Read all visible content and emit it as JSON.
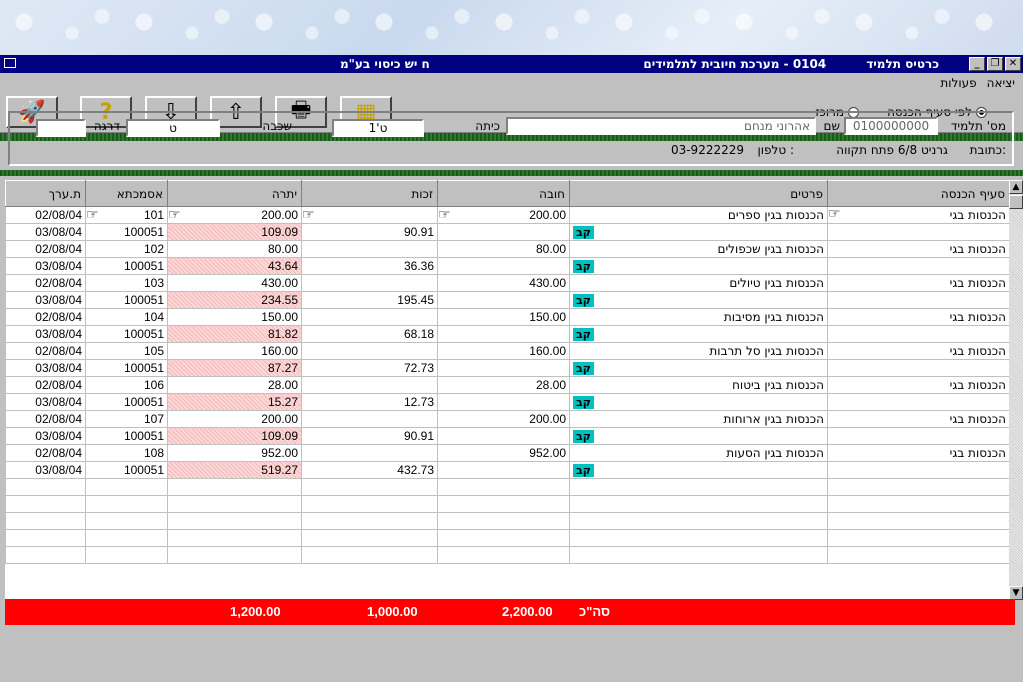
{
  "window": {
    "title": "כרטיס תלמיד",
    "subtitle": "0104 - מערכת חיובית לתלמידים",
    "school": "ח   יש כיסוי בע\"מ"
  },
  "menu": [
    "פעולות",
    "יציאה"
  ],
  "radios": [
    {
      "label": "לפי סעיף הכנסה",
      "checked": true
    },
    {
      "label": "מרוכז",
      "checked": false
    }
  ],
  "toolbar_icons": [
    "exit-rocket-icon",
    "help-icon",
    "arrow-down-icon",
    "arrow-up-icon",
    "print-icon",
    "calculator-icon"
  ],
  "student": {
    "id_label": "מס' תלמיד",
    "id_value": "0100000000",
    "name_label": "שם",
    "name_value": "אהרוני מנחם",
    "class_label": "כיתה",
    "class_value": "ט'1",
    "grade_label": "שכבה",
    "grade_value": "ט",
    "level_label": "דרגה",
    "level_value": "",
    "address_label": "כתובת:",
    "address_value": "גרניט 6/8  פתח תקווה",
    "phone_label": "טלפון :",
    "phone_value": "03-9222229"
  },
  "columns": [
    "סעיף הכנסה",
    "פרטים",
    "חובה",
    "זכות",
    "יתרה",
    "אסמכתא",
    "ת.ערך"
  ],
  "rows": [
    {
      "section": "הכנסות בגי",
      "details": "הכנסות בגין ספרים",
      "debit": "200.00",
      "credit": "",
      "balance": "200.00",
      "ref": "101",
      "date": "02/08/04",
      "hl": false,
      "kav": false,
      "hand": true
    },
    {
      "section": "",
      "details": "",
      "debit": "",
      "credit": "90.91",
      "balance": "109.09",
      "ref": "100051",
      "date": "03/08/04",
      "hl": true,
      "kav": true,
      "hand": false
    },
    {
      "section": "הכנסות בגי",
      "details": "הכנסות בגין שכפולים",
      "debit": "80.00",
      "credit": "",
      "balance": "80.00",
      "ref": "102",
      "date": "02/08/04",
      "hl": false,
      "kav": false,
      "hand": false
    },
    {
      "section": "",
      "details": "",
      "debit": "",
      "credit": "36.36",
      "balance": "43.64",
      "ref": "100051",
      "date": "03/08/04",
      "hl": true,
      "kav": true,
      "hand": false
    },
    {
      "section": "הכנסות בגי",
      "details": "הכנסות בגין טיולים",
      "debit": "430.00",
      "credit": "",
      "balance": "430.00",
      "ref": "103",
      "date": "02/08/04",
      "hl": false,
      "kav": false,
      "hand": false
    },
    {
      "section": "",
      "details": "",
      "debit": "",
      "credit": "195.45",
      "balance": "234.55",
      "ref": "100051",
      "date": "03/08/04",
      "hl": true,
      "kav": true,
      "hand": false
    },
    {
      "section": "הכנסות בגי",
      "details": "הכנסות בגין מסיבות",
      "debit": "150.00",
      "credit": "",
      "balance": "150.00",
      "ref": "104",
      "date": "02/08/04",
      "hl": false,
      "kav": false,
      "hand": false
    },
    {
      "section": "",
      "details": "",
      "debit": "",
      "credit": "68.18",
      "balance": "81.82",
      "ref": "100051",
      "date": "03/08/04",
      "hl": true,
      "kav": true,
      "hand": false
    },
    {
      "section": "הכנסות בגי",
      "details": "הכנסות בגין סל תרבות",
      "debit": "160.00",
      "credit": "",
      "balance": "160.00",
      "ref": "105",
      "date": "02/08/04",
      "hl": false,
      "kav": false,
      "hand": false
    },
    {
      "section": "",
      "details": "",
      "debit": "",
      "credit": "72.73",
      "balance": "87.27",
      "ref": "100051",
      "date": "03/08/04",
      "hl": true,
      "kav": true,
      "hand": false
    },
    {
      "section": "הכנסות בגי",
      "details": "הכנסות בגין ביטוח",
      "debit": "28.00",
      "credit": "",
      "balance": "28.00",
      "ref": "106",
      "date": "02/08/04",
      "hl": false,
      "kav": false,
      "hand": false
    },
    {
      "section": "",
      "details": "",
      "debit": "",
      "credit": "12.73",
      "balance": "15.27",
      "ref": "100051",
      "date": "03/08/04",
      "hl": true,
      "kav": true,
      "hand": false
    },
    {
      "section": "הכנסות בגי",
      "details": "הכנסות בגין ארוחות",
      "debit": "200.00",
      "credit": "",
      "balance": "200.00",
      "ref": "107",
      "date": "02/08/04",
      "hl": false,
      "kav": false,
      "hand": false
    },
    {
      "section": "",
      "details": "",
      "debit": "",
      "credit": "90.91",
      "balance": "109.09",
      "ref": "100051",
      "date": "03/08/04",
      "hl": true,
      "kav": true,
      "hand": false
    },
    {
      "section": "הכנסות בגי",
      "details": "הכנסות בגין הסעות",
      "debit": "952.00",
      "credit": "",
      "balance": "952.00",
      "ref": "108",
      "date": "02/08/04",
      "hl": false,
      "kav": false,
      "hand": false
    },
    {
      "section": "",
      "details": "",
      "debit": "",
      "credit": "432.73",
      "balance": "519.27",
      "ref": "100051",
      "date": "03/08/04",
      "hl": true,
      "kav": true,
      "hand": false
    }
  ],
  "kav_label": "קב",
  "totals": {
    "label": "סה\"כ",
    "debit": "2,200.00",
    "credit": "1,000.00",
    "balance": "1,200.00"
  }
}
